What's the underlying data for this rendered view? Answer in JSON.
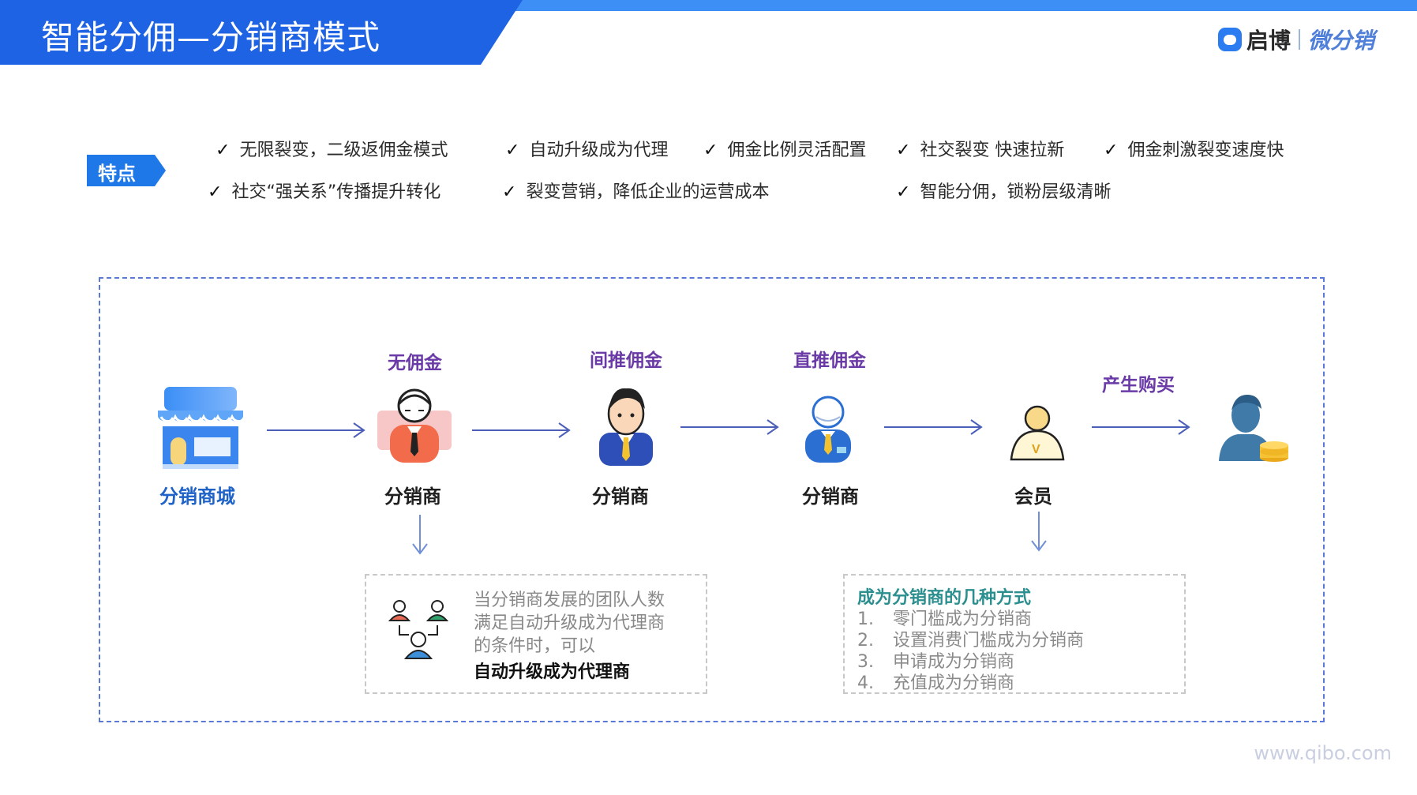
{
  "header": {
    "title": "智能分佣—分销商模式",
    "brand_name": "启博",
    "brand_product": "微分销"
  },
  "features": {
    "tag": "特点",
    "check_glyph": "✓",
    "items": [
      "无限裂变，二级返佣金模式",
      "自动升级成为代理",
      "佣金比例灵活配置",
      "社交裂变 快速拉新",
      "佣金刺激裂变速度快",
      "社交“强关系”传播提升转化",
      "裂变营销，降低企业的运营成本",
      "智能分佣，锁粉层级清晰"
    ]
  },
  "flow": {
    "nodes": [
      {
        "top_label": "",
        "bottom_label": "分销商城",
        "icon": "store-icon"
      },
      {
        "top_label": "无佣金",
        "bottom_label": "分销商",
        "icon": "distributor-elder-icon"
      },
      {
        "top_label": "间推佣金",
        "bottom_label": "分销商",
        "icon": "distributor-businessman-icon"
      },
      {
        "top_label": "直推佣金",
        "bottom_label": "分销商",
        "icon": "distributor-manager-icon"
      },
      {
        "top_label": "",
        "bottom_label": "会员",
        "icon": "member-vip-icon"
      },
      {
        "top_label": "产生购买",
        "bottom_label": "",
        "icon": "buyer-coins-icon"
      }
    ]
  },
  "upgrade_note": {
    "lines": [
      "当分销商发展的团队人数",
      "满足自动升级成为代理商",
      "的条件时，可以"
    ],
    "emphasis": "自动升级成为代理商"
  },
  "methods_note": {
    "title": "成为分销商的几种方式",
    "items": [
      {
        "num": "1.",
        "text": "零门槛成为分销商"
      },
      {
        "num": "2.",
        "text": "设置消费门槛成为分销商"
      },
      {
        "num": "3.",
        "text": "申请成为分销商"
      },
      {
        "num": "4.",
        "text": "充值成为分销商"
      }
    ]
  },
  "footer": {
    "website": "www.qibo.com"
  },
  "colors": {
    "primary_blue": "#1f63e5",
    "accent_purple": "#6a3aa6",
    "arrow_color": "#4b5fb8",
    "methods_title": "#2c8f8f"
  }
}
